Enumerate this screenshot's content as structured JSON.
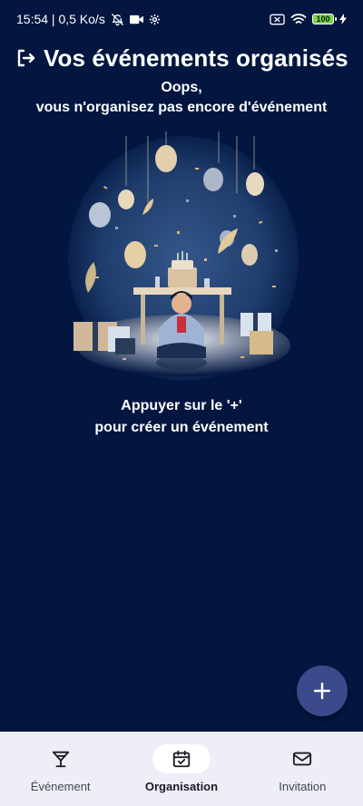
{
  "status_bar": {
    "time_speed": "15:54 | 0,5 Ko/s",
    "battery": "100",
    "icons": [
      "bell-off-icon",
      "video-camera-icon",
      "settings-gear-icon",
      "sim-card-x-icon",
      "wifi-icon",
      "battery-icon",
      "charging-bolt-icon"
    ]
  },
  "header": {
    "title": "Vos événements organisés",
    "logout_icon": "logout-icon"
  },
  "empty_state": {
    "line1": "Oops,",
    "line2": "vous n'organisez pas encore d'événement",
    "illustration": "party-illustration",
    "hint_line1": "Appuyer sur le '+'",
    "hint_line2": "pour créer un événement"
  },
  "fab": {
    "label": "+",
    "icon": "plus-icon"
  },
  "bottom_nav": {
    "items": [
      {
        "label": "Événement",
        "icon": "cocktail-glass-icon",
        "active": false
      },
      {
        "label": "Organisation",
        "icon": "calendar-check-icon",
        "active": true
      },
      {
        "label": "Invitation",
        "icon": "envelope-icon",
        "active": false
      }
    ]
  },
  "colors": {
    "background": "#021640",
    "fab": "#3a4a8a",
    "nav_bar": "#edeef8",
    "battery": "#7cd34a"
  }
}
